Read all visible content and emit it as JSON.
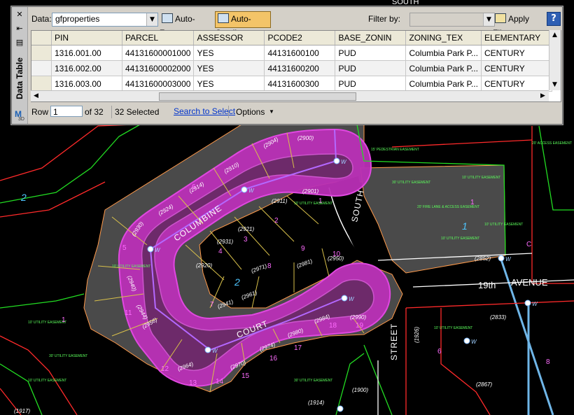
{
  "data_table": {
    "side": {
      "title": "Data Table",
      "close_glyph": "✕",
      "pin_glyph": "⇤",
      "menu_glyph": "▤",
      "logo_letter": "M",
      "logo_sub": "3D"
    },
    "toolbar": {
      "data_label": "Data:",
      "data_value": "gfproperties",
      "auto_zoom_label": "Auto-Zoom",
      "auto_scroll_label": "Auto-Scroll",
      "filter_by_label": "Filter by:",
      "filter_value": "",
      "apply_filter_label": "Apply Filter",
      "help_label": "?"
    },
    "columns": [
      "PIN",
      "PARCEL",
      "ASSESSOR",
      "PCODE2",
      "BASE_ZONIN",
      "ZONING_TEX",
      "ELEMENTARY"
    ],
    "rows": [
      [
        "1316.001.00",
        "44131600001000",
        "YES",
        "44131600100",
        "PUD",
        "Columbia Park P...",
        "CENTURY"
      ],
      [
        "1316.002.00",
        "44131600002000",
        "YES",
        "44131600200",
        "PUD",
        "Columbia Park P...",
        "CENTURY"
      ],
      [
        "1316.003.00",
        "44131600003000",
        "YES",
        "44131600300",
        "PUD",
        "Columbia Park P...",
        "CENTURY"
      ]
    ],
    "status": {
      "row_label": "Row",
      "row_value": "1",
      "of_label": "of 32",
      "selected_label": "32 Selected",
      "search_link": "Search to Select",
      "options_label": "Options"
    }
  },
  "map": {
    "street_labels": {
      "columbine": "COLUMBINE",
      "court": "COURT",
      "south": "SOUTH",
      "street": "STREET",
      "nineteenth": "19th",
      "avenue": "AVENUE",
      "south_top": "SOUTH"
    },
    "lot_numbers": [
      "(2904)",
      "(2900)",
      "(2910)",
      "(2914)",
      "(2924)",
      "(2930)",
      "(2901)",
      "(2911)",
      "(2921)",
      "(2931)",
      "(2920)",
      "(2971)",
      "(2961)",
      "(2981)",
      "(2941)",
      "(2950)",
      "(2956)",
      "(2964)",
      "(2970)",
      "(2974)",
      "(2980)",
      "(2984)",
      "(2990)",
      "(2944)",
      "(2940)",
      "(2852)",
      "(1926)",
      "(2833)",
      "(1900)",
      "(2867)",
      "(1914)",
      "(1917)"
    ],
    "parcel_numbers": [
      "1",
      "2",
      "3",
      "4",
      "5",
      "6",
      "7",
      "8",
      "9",
      "10",
      "11",
      "12",
      "13",
      "14",
      "15",
      "16",
      "17",
      "18",
      "19"
    ],
    "easement_text": [
      "10' UTILITY EASEMENT",
      "20' FIRE LANE & ACCESS EASEMENT",
      "20' ACCESS EASEMENT",
      "30' UTILITY EASEMENT",
      "15' PEDESTRIAN EASEMENT"
    ],
    "big_numbers": [
      "1",
      "2",
      "6",
      "8",
      "C"
    ],
    "water_symbol": "W"
  }
}
